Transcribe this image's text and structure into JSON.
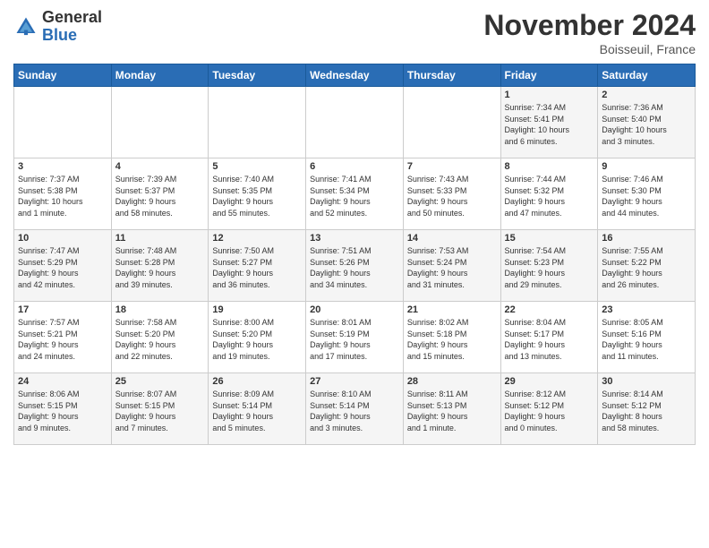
{
  "header": {
    "logo_general": "General",
    "logo_blue": "Blue",
    "month_title": "November 2024",
    "location": "Boisseuil, France"
  },
  "days_of_week": [
    "Sunday",
    "Monday",
    "Tuesday",
    "Wednesday",
    "Thursday",
    "Friday",
    "Saturday"
  ],
  "weeks": [
    [
      {
        "day": "",
        "info": ""
      },
      {
        "day": "",
        "info": ""
      },
      {
        "day": "",
        "info": ""
      },
      {
        "day": "",
        "info": ""
      },
      {
        "day": "",
        "info": ""
      },
      {
        "day": "1",
        "info": "Sunrise: 7:34 AM\nSunset: 5:41 PM\nDaylight: 10 hours\nand 6 minutes."
      },
      {
        "day": "2",
        "info": "Sunrise: 7:36 AM\nSunset: 5:40 PM\nDaylight: 10 hours\nand 3 minutes."
      }
    ],
    [
      {
        "day": "3",
        "info": "Sunrise: 7:37 AM\nSunset: 5:38 PM\nDaylight: 10 hours\nand 1 minute."
      },
      {
        "day": "4",
        "info": "Sunrise: 7:39 AM\nSunset: 5:37 PM\nDaylight: 9 hours\nand 58 minutes."
      },
      {
        "day": "5",
        "info": "Sunrise: 7:40 AM\nSunset: 5:35 PM\nDaylight: 9 hours\nand 55 minutes."
      },
      {
        "day": "6",
        "info": "Sunrise: 7:41 AM\nSunset: 5:34 PM\nDaylight: 9 hours\nand 52 minutes."
      },
      {
        "day": "7",
        "info": "Sunrise: 7:43 AM\nSunset: 5:33 PM\nDaylight: 9 hours\nand 50 minutes."
      },
      {
        "day": "8",
        "info": "Sunrise: 7:44 AM\nSunset: 5:32 PM\nDaylight: 9 hours\nand 47 minutes."
      },
      {
        "day": "9",
        "info": "Sunrise: 7:46 AM\nSunset: 5:30 PM\nDaylight: 9 hours\nand 44 minutes."
      }
    ],
    [
      {
        "day": "10",
        "info": "Sunrise: 7:47 AM\nSunset: 5:29 PM\nDaylight: 9 hours\nand 42 minutes."
      },
      {
        "day": "11",
        "info": "Sunrise: 7:48 AM\nSunset: 5:28 PM\nDaylight: 9 hours\nand 39 minutes."
      },
      {
        "day": "12",
        "info": "Sunrise: 7:50 AM\nSunset: 5:27 PM\nDaylight: 9 hours\nand 36 minutes."
      },
      {
        "day": "13",
        "info": "Sunrise: 7:51 AM\nSunset: 5:26 PM\nDaylight: 9 hours\nand 34 minutes."
      },
      {
        "day": "14",
        "info": "Sunrise: 7:53 AM\nSunset: 5:24 PM\nDaylight: 9 hours\nand 31 minutes."
      },
      {
        "day": "15",
        "info": "Sunrise: 7:54 AM\nSunset: 5:23 PM\nDaylight: 9 hours\nand 29 minutes."
      },
      {
        "day": "16",
        "info": "Sunrise: 7:55 AM\nSunset: 5:22 PM\nDaylight: 9 hours\nand 26 minutes."
      }
    ],
    [
      {
        "day": "17",
        "info": "Sunrise: 7:57 AM\nSunset: 5:21 PM\nDaylight: 9 hours\nand 24 minutes."
      },
      {
        "day": "18",
        "info": "Sunrise: 7:58 AM\nSunset: 5:20 PM\nDaylight: 9 hours\nand 22 minutes."
      },
      {
        "day": "19",
        "info": "Sunrise: 8:00 AM\nSunset: 5:20 PM\nDaylight: 9 hours\nand 19 minutes."
      },
      {
        "day": "20",
        "info": "Sunrise: 8:01 AM\nSunset: 5:19 PM\nDaylight: 9 hours\nand 17 minutes."
      },
      {
        "day": "21",
        "info": "Sunrise: 8:02 AM\nSunset: 5:18 PM\nDaylight: 9 hours\nand 15 minutes."
      },
      {
        "day": "22",
        "info": "Sunrise: 8:04 AM\nSunset: 5:17 PM\nDaylight: 9 hours\nand 13 minutes."
      },
      {
        "day": "23",
        "info": "Sunrise: 8:05 AM\nSunset: 5:16 PM\nDaylight: 9 hours\nand 11 minutes."
      }
    ],
    [
      {
        "day": "24",
        "info": "Sunrise: 8:06 AM\nSunset: 5:15 PM\nDaylight: 9 hours\nand 9 minutes."
      },
      {
        "day": "25",
        "info": "Sunrise: 8:07 AM\nSunset: 5:15 PM\nDaylight: 9 hours\nand 7 minutes."
      },
      {
        "day": "26",
        "info": "Sunrise: 8:09 AM\nSunset: 5:14 PM\nDaylight: 9 hours\nand 5 minutes."
      },
      {
        "day": "27",
        "info": "Sunrise: 8:10 AM\nSunset: 5:14 PM\nDaylight: 9 hours\nand 3 minutes."
      },
      {
        "day": "28",
        "info": "Sunrise: 8:11 AM\nSunset: 5:13 PM\nDaylight: 9 hours\nand 1 minute."
      },
      {
        "day": "29",
        "info": "Sunrise: 8:12 AM\nSunset: 5:12 PM\nDaylight: 9 hours\nand 0 minutes."
      },
      {
        "day": "30",
        "info": "Sunrise: 8:14 AM\nSunset: 5:12 PM\nDaylight: 8 hours\nand 58 minutes."
      }
    ]
  ]
}
